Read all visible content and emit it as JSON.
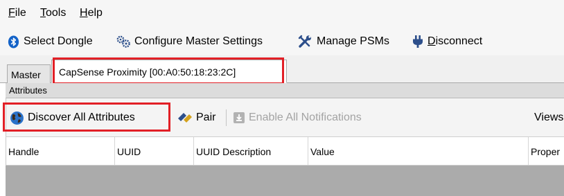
{
  "menu": {
    "file": {
      "accel": "F",
      "rest": "ile"
    },
    "tools": {
      "accel": "T",
      "rest": "ools"
    },
    "help": {
      "accel": "H",
      "rest": "elp"
    }
  },
  "toolbar": {
    "select_dongle": "Select Dongle",
    "configure_master": "Configure Master Settings",
    "manage_psms": "Manage PSMs",
    "disconnect": {
      "accel": "D",
      "rest": "isconnect"
    }
  },
  "tabs": {
    "master": "Master",
    "device": "CapSense Proximity [00:A0:50:18:23:2C]"
  },
  "attributes": {
    "title": "Attributes",
    "discover_all": "Discover All Attributes",
    "pair": "Pair",
    "enable_all_notifications": "Enable All Notifications",
    "views": "Views:",
    "columns": [
      "Handle",
      "UUID",
      "UUID Description",
      "Value",
      "Proper"
    ]
  },
  "colors": {
    "highlight": "#e21f26",
    "bluetooth": "#1463c8",
    "disabled_text": "#a3a3a3"
  },
  "icons": [
    "bluetooth-icon",
    "gears-icon",
    "wrench-icon",
    "plug-icon",
    "globe-icon",
    "pair-icon",
    "notification-icon"
  ]
}
